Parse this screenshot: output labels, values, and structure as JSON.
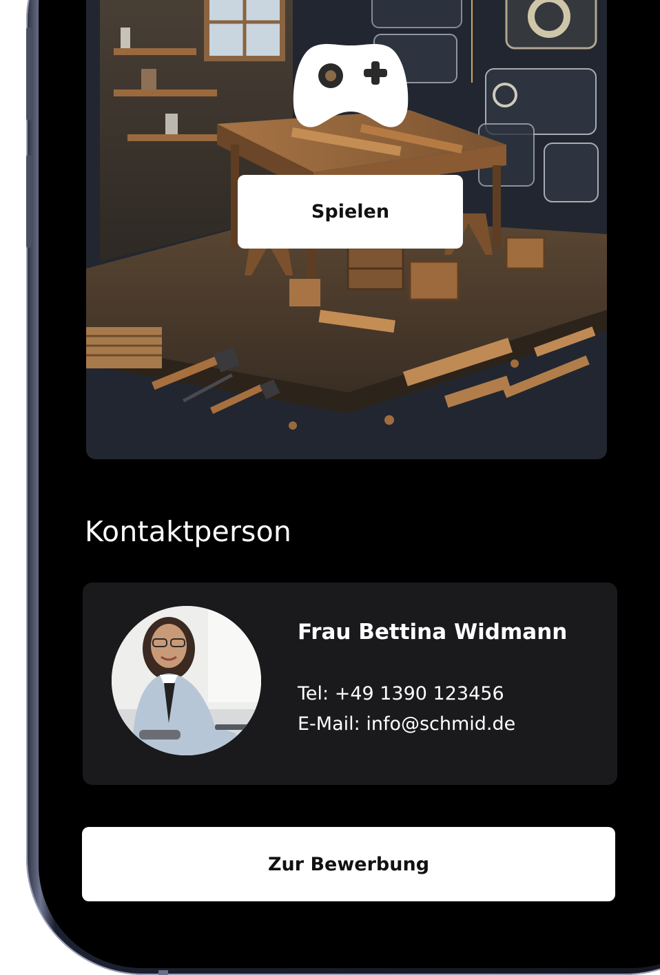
{
  "game": {
    "play_label": "Spielen",
    "icon": "gamepad-icon"
  },
  "contact": {
    "section_title": "Kontaktperson",
    "name": "Frau Bettina Widmann",
    "tel": "Tel: +49 1390 123456",
    "email": "E-Mail: info@schmid.de",
    "avatar": "avatar-photo"
  },
  "actions": {
    "apply_label": "Zur Bewerbung"
  },
  "colors": {
    "screen_bg": "#000000",
    "card_bg": "#1a1a1d",
    "button_bg": "#ffffff",
    "text_light": "#ffffff",
    "text_dark": "#111111"
  }
}
